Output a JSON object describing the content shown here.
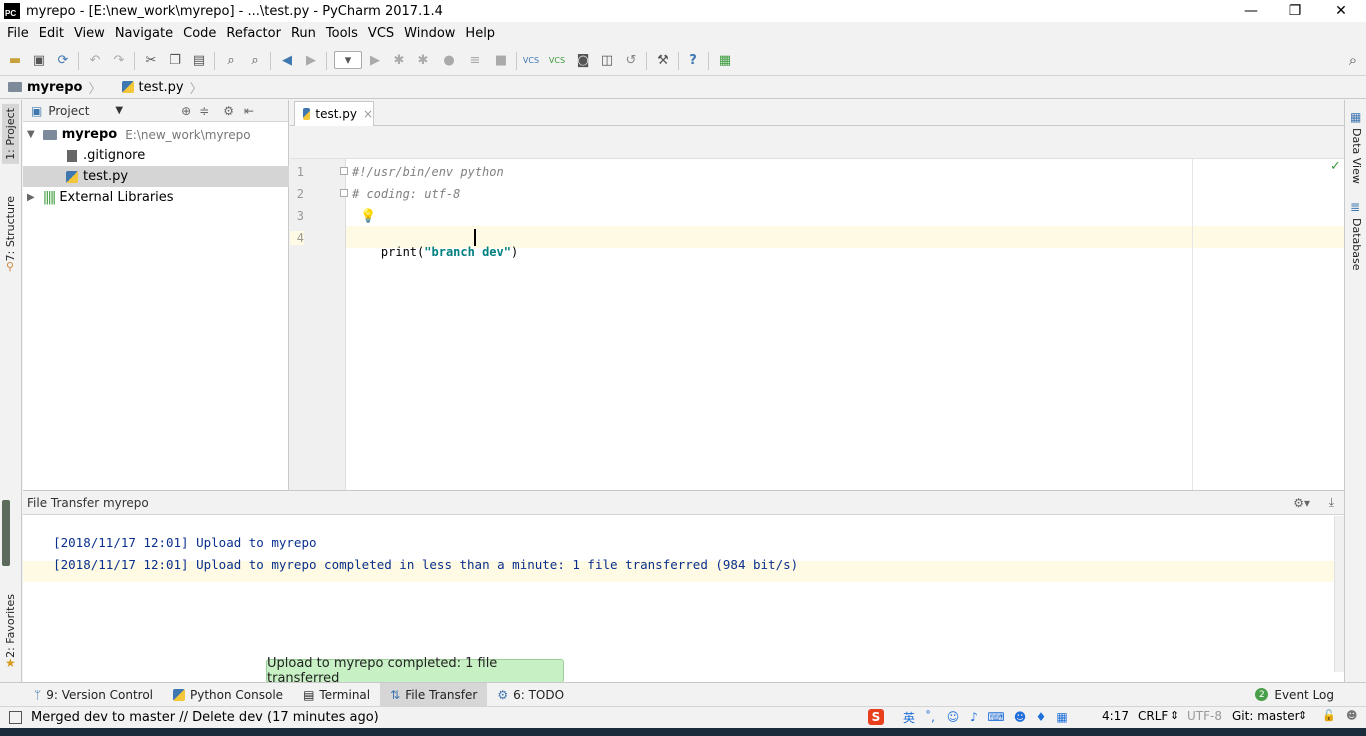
{
  "window": {
    "title": "myrepo - [E:\\new_work\\myrepo] - ...\\test.py - PyCharm 2017.1.4",
    "logo": "PC",
    "minimize": "—",
    "restore": "❐",
    "close": "✕"
  },
  "menu": [
    "File",
    "Edit",
    "View",
    "Navigate",
    "Code",
    "Refactor",
    "Run",
    "Tools",
    "VCS",
    "Window",
    "Help"
  ],
  "breadcrumb": {
    "project": "myrepo",
    "file": "test.py"
  },
  "left_tabs": {
    "project": "1: Project",
    "structure": "7: Structure",
    "favorites": "2: Favorites"
  },
  "right_tabs": {
    "data_view": "Data View",
    "database": "Database"
  },
  "project_panel": {
    "header": "Project",
    "root_name": "myrepo",
    "root_path": "E:\\new_work\\myrepo",
    "files": [
      ".gitignore",
      "test.py"
    ],
    "external": "External Libraries"
  },
  "editor": {
    "tab_label": "test.py",
    "tab_close": "×",
    "line_numbers": [
      "1",
      "2",
      "3",
      "4"
    ],
    "line1": "#!/usr/bin/env python",
    "line2": "# coding: utf-8",
    "line4_func": "print(",
    "line4_str": "\"branch dev\"",
    "line4_close": ")"
  },
  "file_transfer": {
    "header": "File Transfer myrepo",
    "log": [
      {
        "time": "[2018/11/17 12:01]",
        "msg": " Upload to myrepo"
      },
      {
        "time": "[2018/11/17 12:01]",
        "msg": " Upload to myrepo completed in less than a minute: 1 file transferred (984 bit/s)"
      }
    ]
  },
  "balloon": "Upload to myrepo completed: 1 file transferred",
  "tool_windows": {
    "version_control": "9: Version Control",
    "python_console": "Python Console",
    "terminal": "Terminal",
    "file_transfer": "File Transfer",
    "todo": "6: TODO",
    "event_log": "Event Log",
    "event_count": "2"
  },
  "status": {
    "message": "Merged dev to master // Delete dev (17 minutes ago)",
    "position": "4:17",
    "line_sep": "CRLF",
    "encoding": "UTF-8",
    "vcs": "Git: master"
  },
  "colors": {
    "accent": "#3f77b0",
    "balloon": "#c7f1c4",
    "string": "#008080",
    "log_text": "#0a2f8f",
    "current_line": "#fffae3"
  }
}
